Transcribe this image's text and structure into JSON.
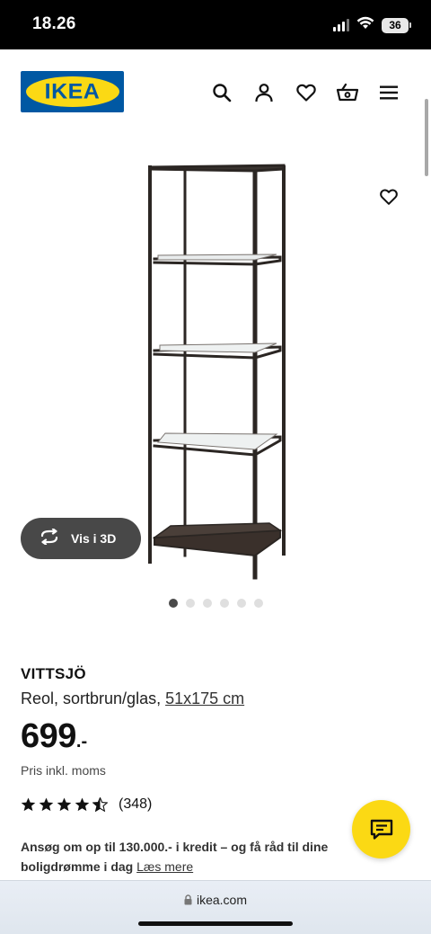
{
  "status_bar": {
    "time": "18.26",
    "battery": "36"
  },
  "header": {
    "logo_text": "IKEA",
    "icons": [
      "search-icon",
      "account-icon",
      "heart-icon",
      "basket-icon",
      "menu-icon"
    ]
  },
  "gallery": {
    "view_3d_label": "Vis i 3D",
    "dot_count": 6,
    "active_dot": 1
  },
  "product": {
    "name": "VITTSJÖ",
    "description": "Reol, sortbrun/glas, ",
    "size": "51x175 cm",
    "price": "699",
    "price_suffix": ".-",
    "price_note": "Pris inkl. moms",
    "rating": 4.5,
    "review_count": "(348)"
  },
  "credit": {
    "text": "Ansøg om op til 130.000.- i kredit – og få råd til dine boligdrømme i dag",
    "link": "Læs mere"
  },
  "browser": {
    "url": "ikea.com"
  },
  "colors": {
    "ikea_blue": "#0058a3",
    "ikea_yellow": "#fbd914",
    "frame_dark": "#2b2623"
  }
}
